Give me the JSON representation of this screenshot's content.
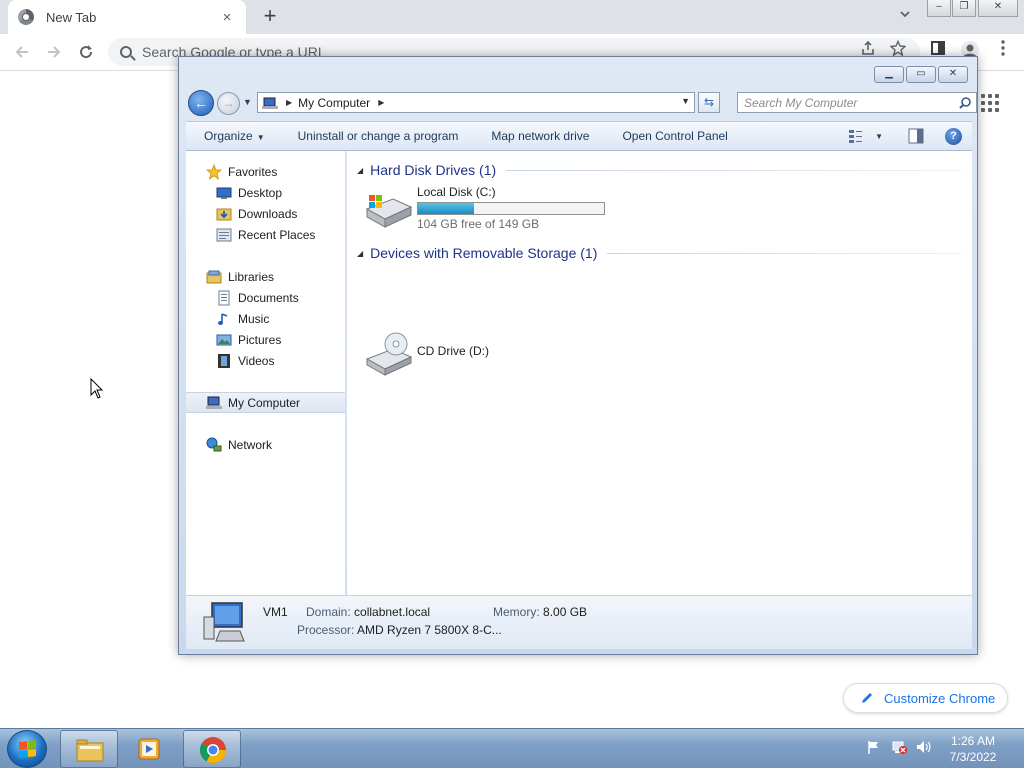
{
  "browser": {
    "tab_title": "New Tab",
    "tab_close": "×",
    "new_tab": "+",
    "omnibox_placeholder": "Search Google or type a URL",
    "customize_label": "Customize Chrome"
  },
  "explorer": {
    "address": {
      "location": "My Computer"
    },
    "search_placeholder": "Search My Computer",
    "commands": {
      "organize": "Organize",
      "uninstall": "Uninstall or change a program",
      "map_drive": "Map network drive",
      "control_panel": "Open Control Panel"
    },
    "nav": {
      "favorites": "Favorites",
      "desktop": "Desktop",
      "downloads": "Downloads",
      "recent": "Recent Places",
      "libraries": "Libraries",
      "documents": "Documents",
      "music": "Music",
      "pictures": "Pictures",
      "videos": "Videos",
      "computer": "My Computer",
      "network": "Network"
    },
    "groups": {
      "hdd": "Hard Disk Drives (1)",
      "removable": "Devices with Removable Storage (1)"
    },
    "drives": {
      "c_name": "Local Disk (C:)",
      "c_free": "104 GB free of 149 GB",
      "c_used_fraction": 0.302,
      "d_name": "CD Drive (D:)"
    },
    "details": {
      "name": "VM1",
      "domain_label": "Domain:",
      "domain_value": "collabnet.local",
      "memory_label": "Memory:",
      "memory_value": "8.00 GB",
      "processor_label": "Processor:",
      "processor_value": "AMD Ryzen 7 5800X 8-C..."
    }
  },
  "taskbar": {
    "time": "1:26 AM",
    "date": "7/3/2022"
  },
  "colors": {
    "accent": "#1a73e8",
    "group_title": "#1e3287",
    "drive_bar": "#1d8bc0"
  }
}
